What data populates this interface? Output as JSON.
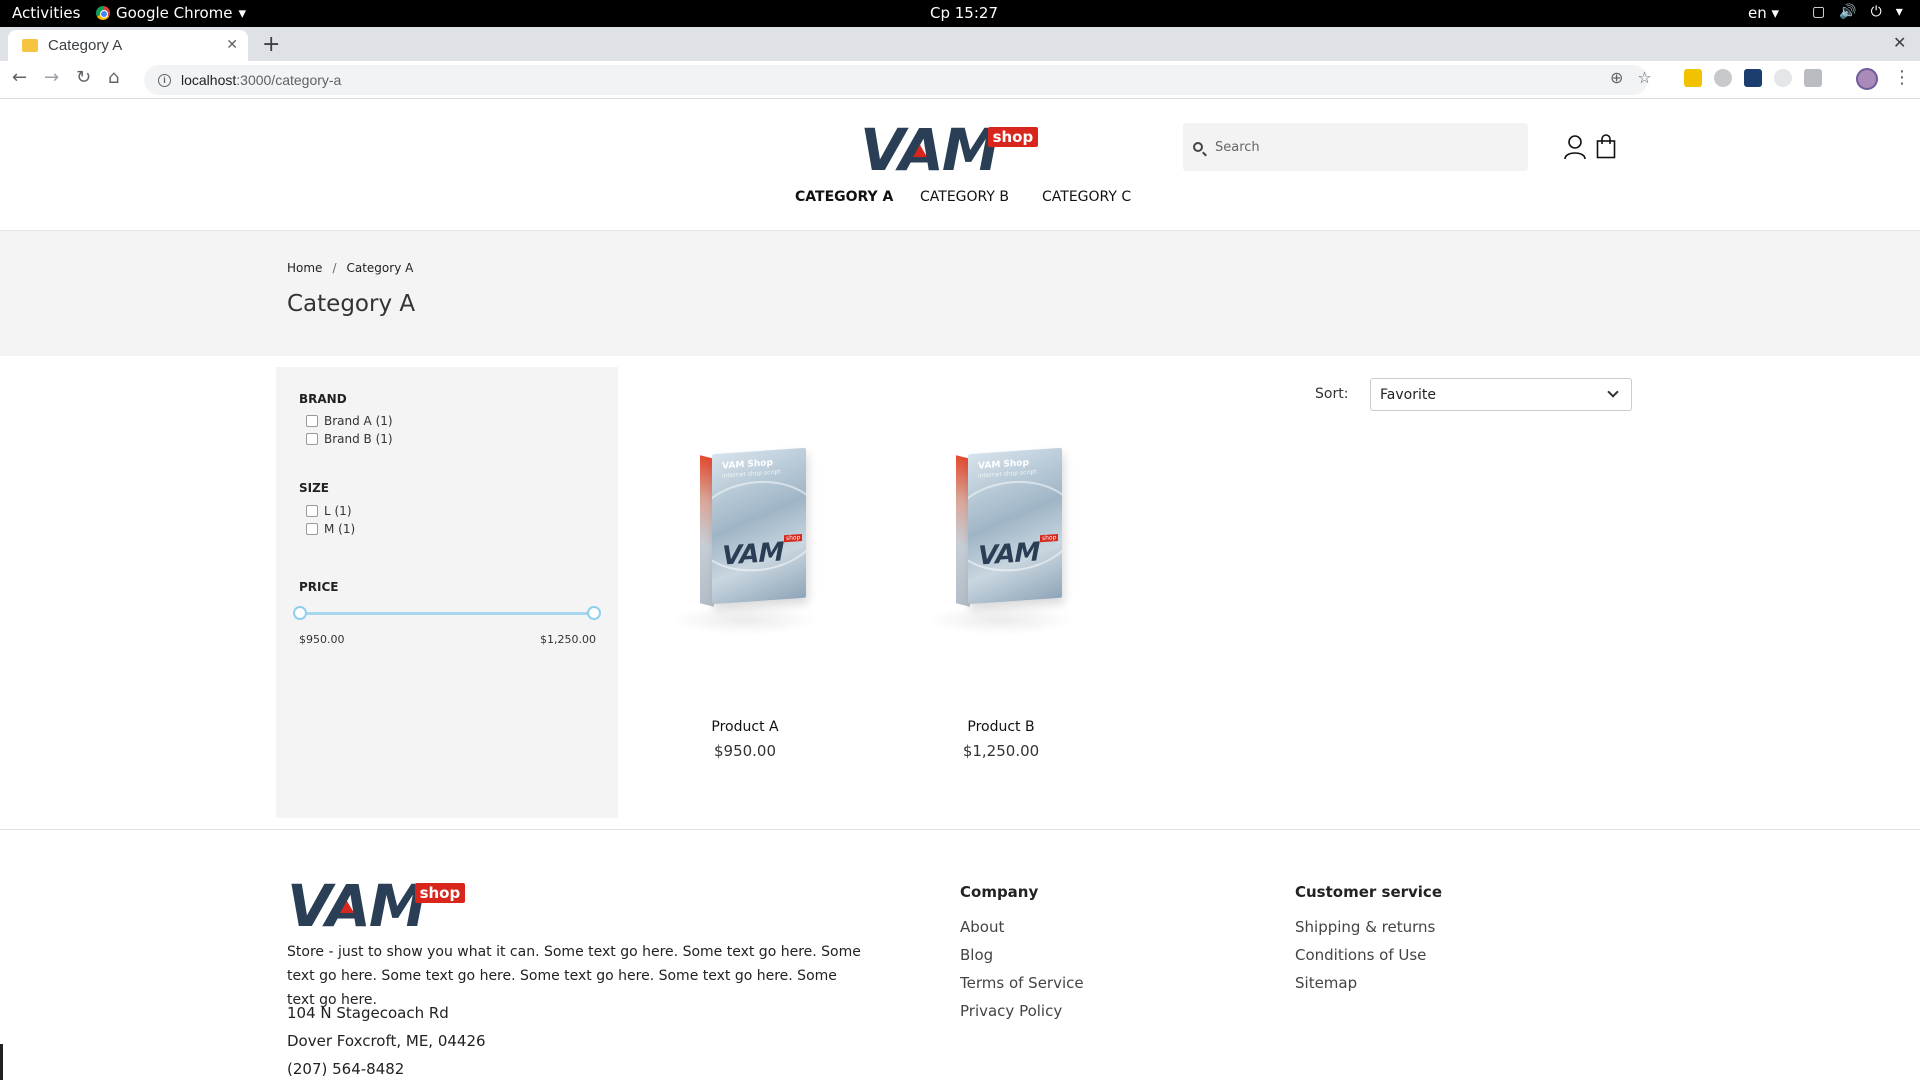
{
  "os_bar": {
    "activities": "Activities",
    "app_name": "Google Chrome",
    "clock": "Cp 15:27",
    "lang": "en"
  },
  "browser": {
    "tab_title": "Category A",
    "url_host": "localhost",
    "url_path": ":3000/category-a"
  },
  "header": {
    "logo_text_1": "V",
    "logo_text_2": "A",
    "logo_text_3": "M",
    "logo_badge": "shop",
    "search_placeholder": "Search",
    "nav": [
      "CATEGORY A",
      "CATEGORY B",
      "CATEGORY C"
    ]
  },
  "breadcrumb": {
    "home": "Home",
    "sep": "/",
    "current": "Category A"
  },
  "page_title": "Category A",
  "filters": {
    "brand_title": "BRAND",
    "brands": [
      "Brand A (1)",
      "Brand B (1)"
    ],
    "size_title": "SIZE",
    "sizes": [
      "L (1)",
      "M (1)"
    ],
    "price_title": "PRICE",
    "price_min": "$950.00",
    "price_max": "$1,250.00"
  },
  "sort": {
    "label": "Sort:",
    "selected": "Favorite"
  },
  "products": [
    {
      "box_title": "VAM Shop",
      "box_sub": "internet shop script",
      "box_logo": "VAM",
      "box_badge": "shop",
      "name": "Product A",
      "price": "$950.00"
    },
    {
      "box_title": "VAM Shop",
      "box_sub": "internet shop script",
      "box_logo": "VAM",
      "box_badge": "shop",
      "name": "Product B",
      "price": "$1,250.00"
    }
  ],
  "footer": {
    "description": "Store - just to show you what it can. Some text go here. Some text go here. Some text go here. Some text go here. Some text go here. Some text go here. Some text go here.",
    "address_line1": "104 N Stagecoach Rd",
    "address_line2": "Dover Foxcroft, ME, 04426",
    "phone": "(207) 564-8482",
    "company_title": "Company",
    "company_links": [
      "About",
      "Blog",
      "Terms of Service",
      "Privacy Policy"
    ],
    "service_title": "Customer service",
    "service_links": [
      "Shipping & returns",
      "Conditions of Use",
      "Sitemap"
    ]
  }
}
